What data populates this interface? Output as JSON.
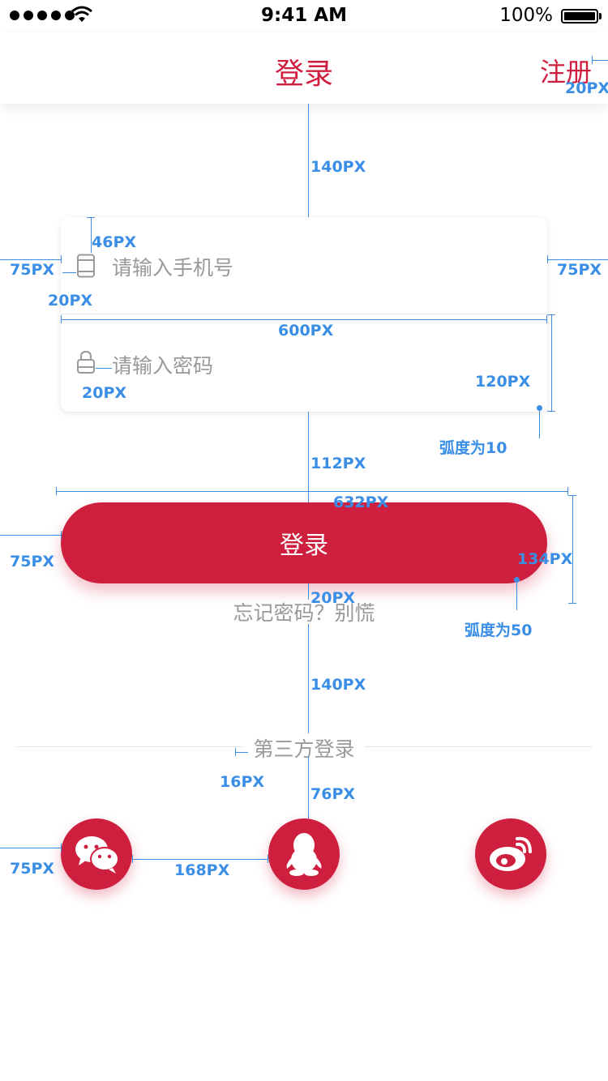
{
  "status_bar": {
    "time": "9:41 AM",
    "battery": "100%"
  },
  "nav": {
    "title": "登录",
    "register": "注册"
  },
  "form": {
    "phone_placeholder": "请输入手机号",
    "password_placeholder": "请输入密码"
  },
  "login_button": "登录",
  "forgot_password": "忘记密码？别慌",
  "third_party_label": "第三方登录",
  "social": [
    "wechat-icon",
    "qq-icon",
    "weibo-icon"
  ],
  "colors": {
    "brand": "#cf1f3e",
    "annotation": "#3a8ee6",
    "placeholder": "#999999"
  },
  "annotations": {
    "nav_right": "20PX",
    "nav_to_card": "140PX",
    "icon_top": "46PX",
    "left_margin": "75PX",
    "right_margin": "75PX",
    "icon_gap_phone": "20PX",
    "card_width": "600PX",
    "icon_gap_lock": "20PX",
    "row_height": "120PX",
    "card_radius": "弧度为10",
    "card_to_button": "112PX",
    "button_shadow_width": "632PX",
    "button_left": "75PX",
    "button_height": "134PX",
    "button_to_forgot": "20PX",
    "button_radius": "弧度为50",
    "forgot_to_third": "140PX",
    "third_text_gap": "16PX",
    "third_to_icons": "76PX",
    "icons_left": "75PX",
    "icons_gap": "168PX"
  }
}
